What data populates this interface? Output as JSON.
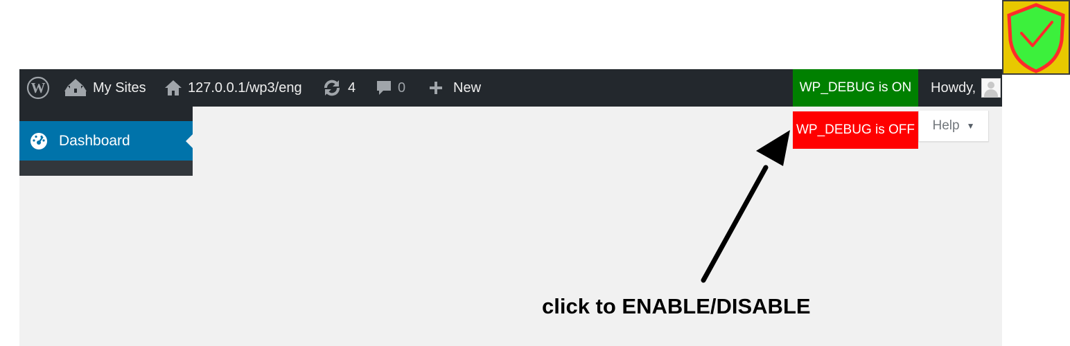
{
  "admin_bar": {
    "my_sites_label": "My Sites",
    "site_url": "127.0.0.1/wp3/eng",
    "updates_count": "4",
    "comments_count": "0",
    "new_label": "New",
    "debug_on_label": "WP_DEBUG is ON",
    "howdy_label": "Howdy,"
  },
  "dropdown": {
    "debug_off_label": "WP_DEBUG is OFF"
  },
  "sidebar": {
    "dashboard_label": "Dashboard"
  },
  "screen_meta": {
    "help_label": "Help"
  },
  "annotation": {
    "text": "click to ENABLE/DISABLE"
  },
  "colors": {
    "admin_bar_bg": "#23282d",
    "debug_on_bg": "#008000",
    "debug_off_bg": "#ff0000",
    "menu_active_bg": "#0073aa",
    "badge_bg": "#e8c800",
    "shield_fill": "#3cf03c",
    "shield_stroke": "#ff2a2a"
  },
  "icons": {
    "wp_logo": "wordpress-logo-icon",
    "my_sites": "my-sites-icon",
    "home": "home-icon",
    "updates": "updates-icon",
    "comments": "comment-icon",
    "new": "plus-icon",
    "dashboard": "dashboard-icon",
    "badge": "shield-check-icon"
  }
}
